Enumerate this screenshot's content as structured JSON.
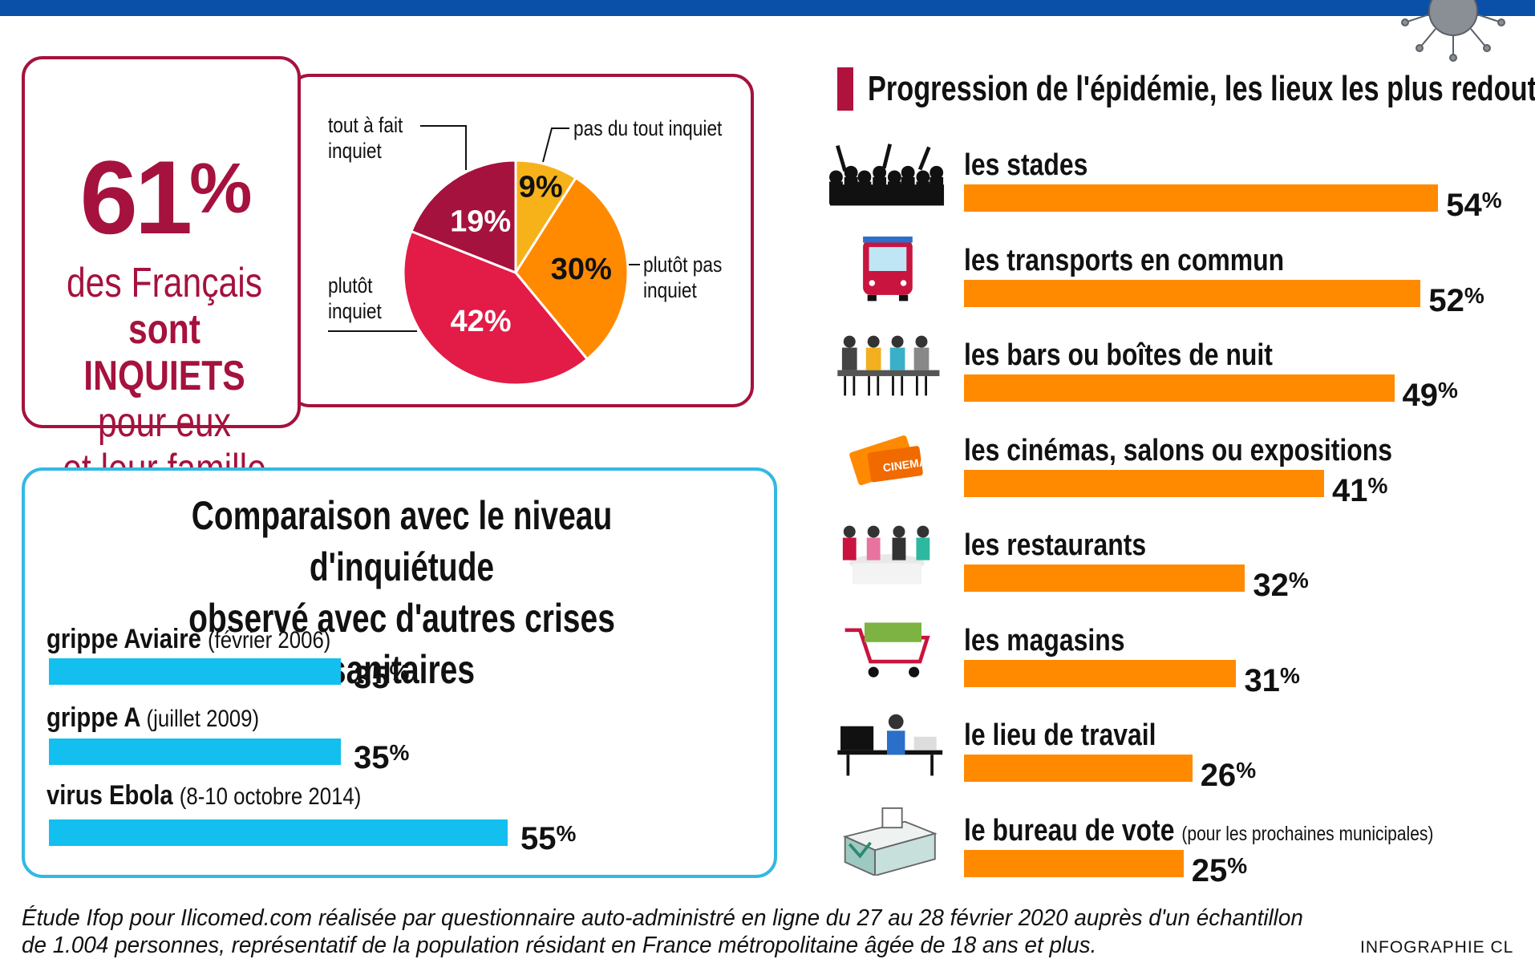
{
  "colors": {
    "brand_red": "#a5123d",
    "top_band": "#0a4fa8",
    "cyan": "#12bfee",
    "cyan_border": "#34b8e3",
    "orange": "#ff8a00"
  },
  "headline": {
    "number": "61",
    "percent_sign": "%",
    "lines": [
      "des Français",
      "sont INQUIETS",
      "pour eux",
      "et leur famille"
    ]
  },
  "pie": {
    "labels": {
      "tout_a_fait": [
        "tout à fait",
        "inquiet"
      ],
      "pas_du_tout": [
        "pas du tout inquiet"
      ],
      "plutot_pas": [
        "plutôt pas",
        "inquiet"
      ],
      "plutot": [
        "plutôt",
        "inquiet"
      ]
    }
  },
  "comparison": {
    "title_lines": [
      "Comparaison avec le niveau d'inquiétude",
      "observé avec d'autres crises sanitaires"
    ]
  },
  "places": {
    "title": "Progression de l'épidémie, les lieux les plus redoutés :",
    "icons": [
      "crowd-icon",
      "bus-icon",
      "bar-icon",
      "cinema-ticket-icon",
      "restaurant-icon",
      "shopping-cart-icon",
      "office-worker-icon",
      "ballot-box-icon"
    ]
  },
  "chart_data": [
    {
      "type": "pie",
      "title": "",
      "unit": "%",
      "slices": [
        {
          "label": "pas du tout inquiet",
          "value": 9,
          "color": "#f7b21a"
        },
        {
          "label": "plutôt pas inquiet",
          "value": 30,
          "color": "#ff8a00"
        },
        {
          "label": "plutôt inquiet",
          "value": 42,
          "color": "#e31b47"
        },
        {
          "label": "tout à fait inquiet",
          "value": 19,
          "color": "#a5123d"
        }
      ],
      "value_labels": [
        "9%",
        "30%",
        "42%",
        "19%"
      ]
    },
    {
      "type": "bar",
      "orientation": "horizontal",
      "title": "Comparaison avec le niveau d'inquiétude observé avec d'autres crises sanitaires",
      "categories": [
        "grippe Aviaire",
        "grippe A",
        "virus Ebola"
      ],
      "dates": [
        "(février 2006)",
        "(juillet 2009)",
        "(8-10 octobre 2014)"
      ],
      "values": [
        35,
        35,
        55
      ],
      "value_labels": [
        "35%",
        "35%",
        "55%"
      ],
      "color": "#12bfee"
    },
    {
      "type": "bar",
      "orientation": "horizontal",
      "title": "Progression de l'épidémie, les lieux les plus redoutés :",
      "categories": [
        "les stades",
        "les transports en commun",
        "les bars ou boîtes de nuit",
        "les cinémas, salons ou expositions",
        "les restaurants",
        "les magasins",
        "le lieu de travail",
        "le bureau de vote"
      ],
      "notes": [
        "",
        "",
        "",
        "",
        "",
        "",
        "",
        "(pour les prochaines municipales)"
      ],
      "values": [
        54,
        52,
        49,
        41,
        32,
        31,
        26,
        25
      ],
      "value_labels": [
        "54%",
        "52%",
        "49%",
        "41%",
        "32%",
        "31%",
        "26%",
        "25%"
      ],
      "color": "#ff8a00"
    }
  ],
  "footer": {
    "source_lines": [
      "Étude Ifop pour Ilicomed.com réalisée par questionnaire auto-administré en ligne du 27 au 28 février 2020 auprès d'un échantillon",
      "de 1.004 personnes, représentatif de la population résidant en France métropolitaine âgée de 18 ans et plus."
    ],
    "credit": "INFOGRAPHIE CL"
  }
}
